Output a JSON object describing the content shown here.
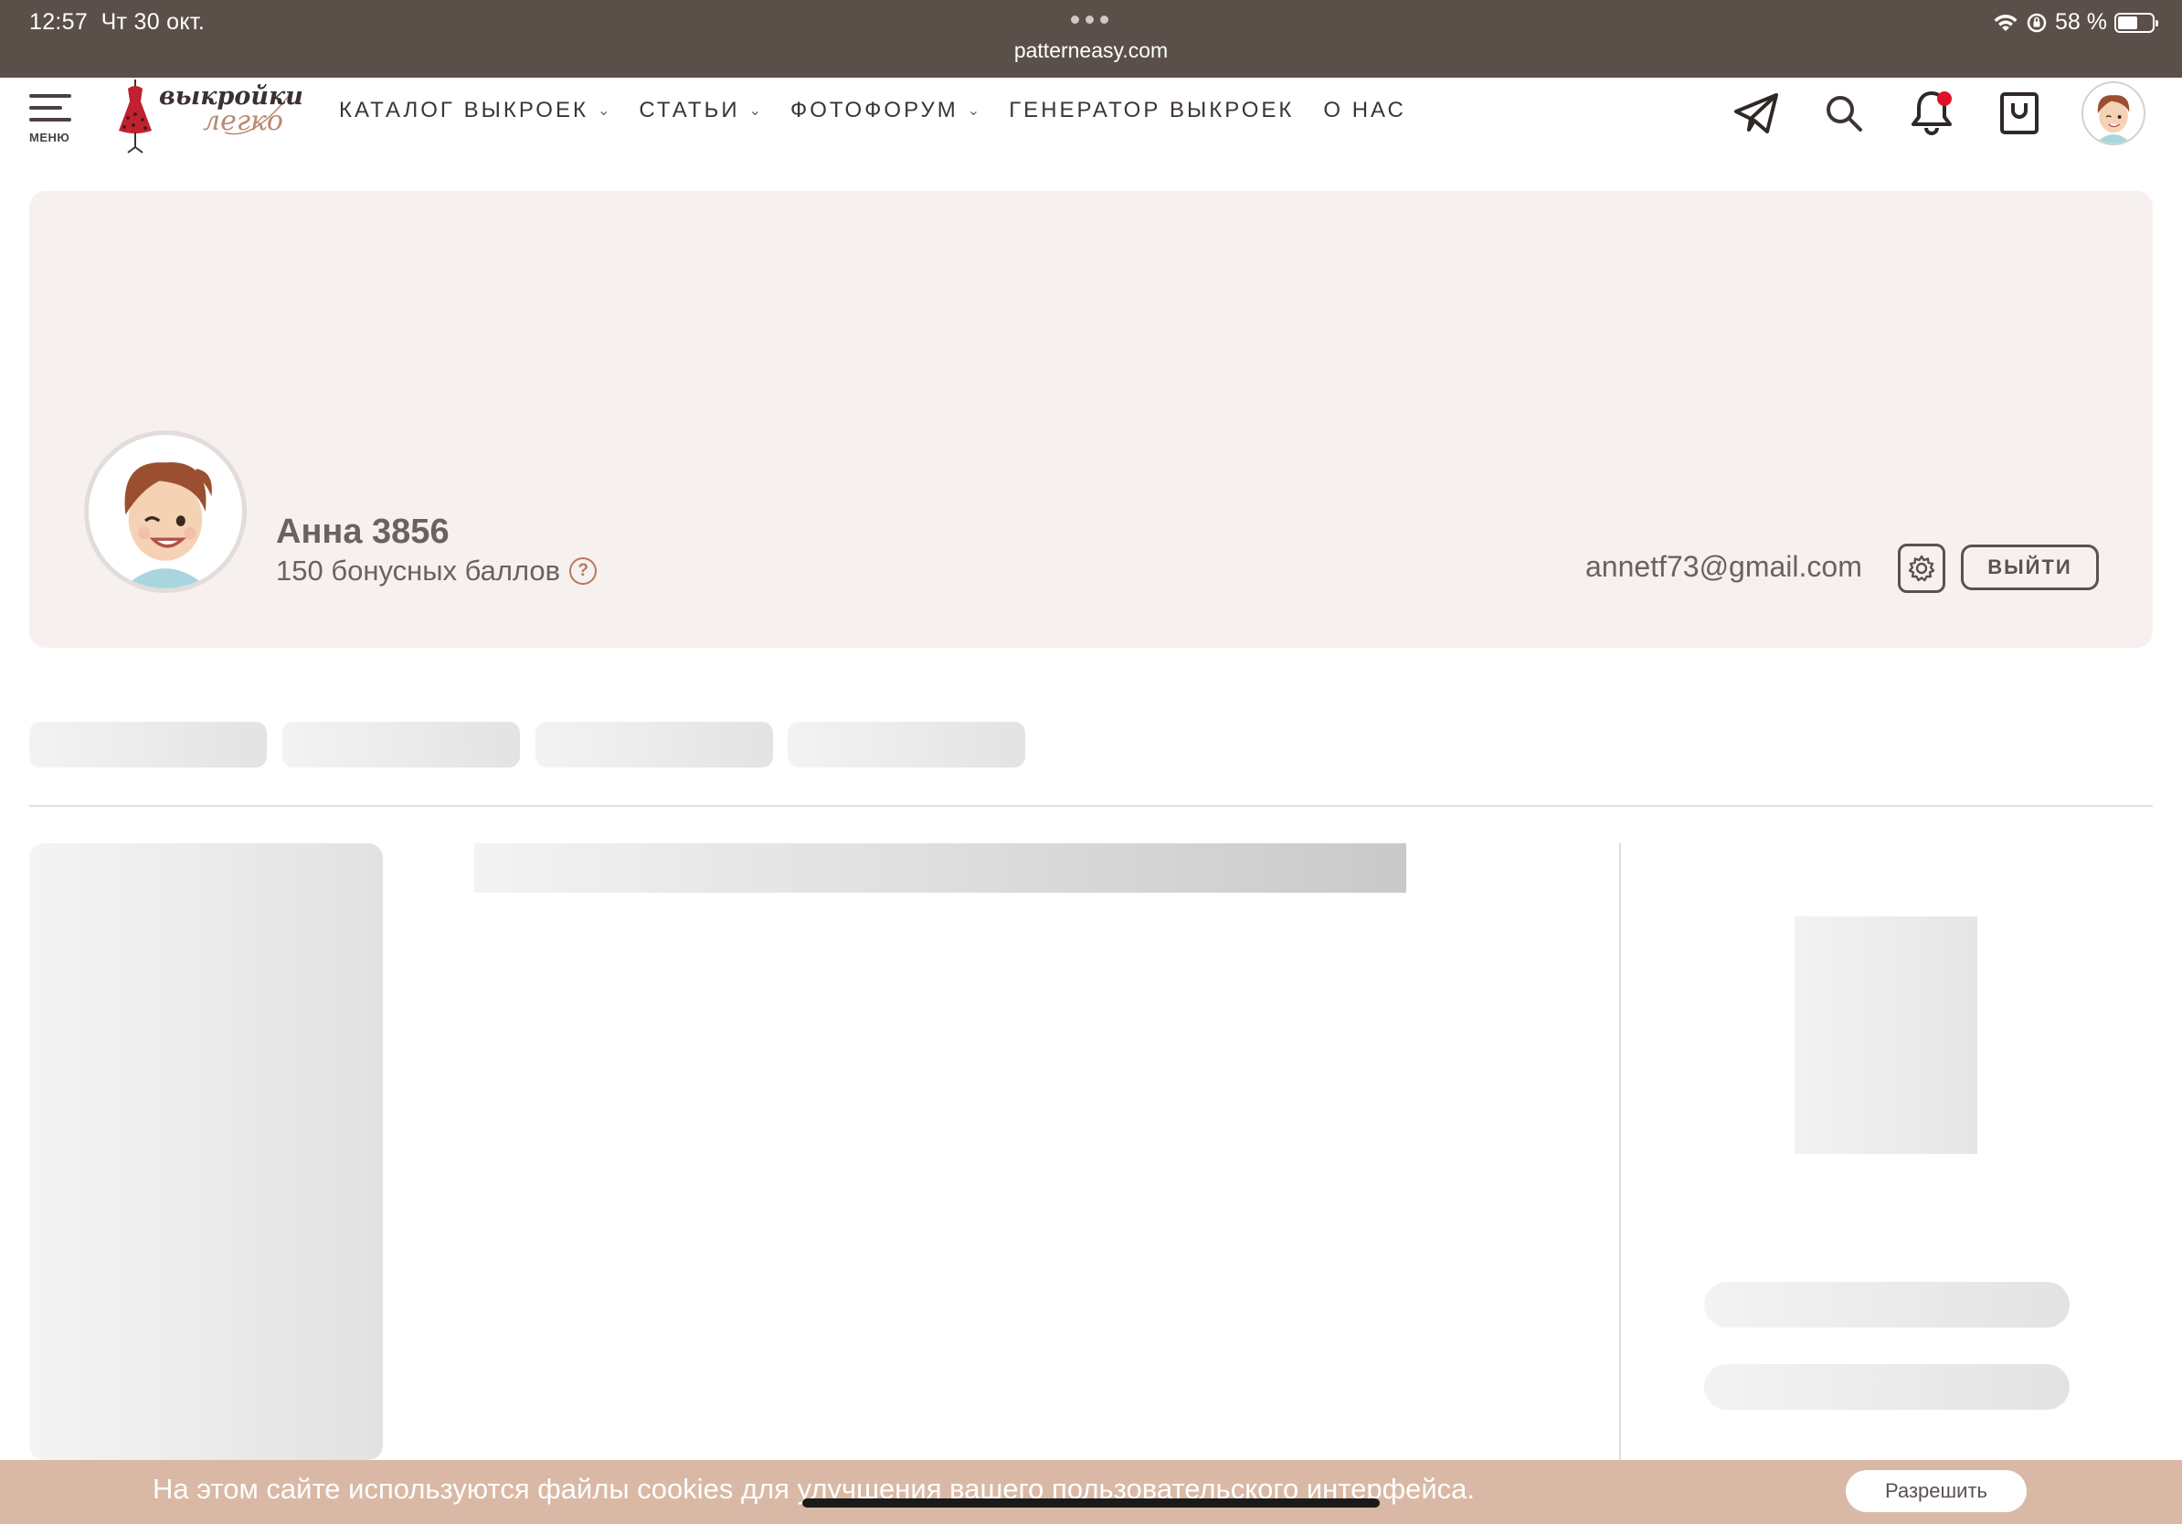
{
  "status_bar": {
    "time": "12:57",
    "date": "Чт 30 окт.",
    "url": "patterneasy.com",
    "battery": "58 %",
    "battery_level": 0.58
  },
  "nav": {
    "menu_label": "МЕНЮ",
    "logo_line1": "выкройки",
    "logo_line2": "легко",
    "links": [
      {
        "label": "КАТАЛОГ ВЫКРОЕК",
        "dropdown": true
      },
      {
        "label": "СТАТЬИ",
        "dropdown": true
      },
      {
        "label": "ФОТОФОРУМ",
        "dropdown": true
      },
      {
        "label": "ГЕНЕРАТОР ВЫКРОЕК",
        "dropdown": false
      },
      {
        "label": "О НАС",
        "dropdown": false
      }
    ],
    "icons": [
      "telegram-icon",
      "search-icon",
      "bell-icon",
      "bag-icon"
    ],
    "notification_color": "#e0102a"
  },
  "profile": {
    "name": "Анна 3856",
    "bonus": "150 бонусных баллов",
    "help": "?",
    "email": "annetf73@gmail.com",
    "logout_label": "ВЫЙТИ"
  },
  "cookie": {
    "text": "На этом сайте используются файлы cookies для улучшения вашего пользовательского интерфейса.",
    "button_label": "Разрешить"
  },
  "colors": {
    "status_bar": "#5b5049",
    "banner": "#f6f0ee",
    "cookie_bar": "#d9b9a5",
    "accent": "#b47a5a"
  }
}
